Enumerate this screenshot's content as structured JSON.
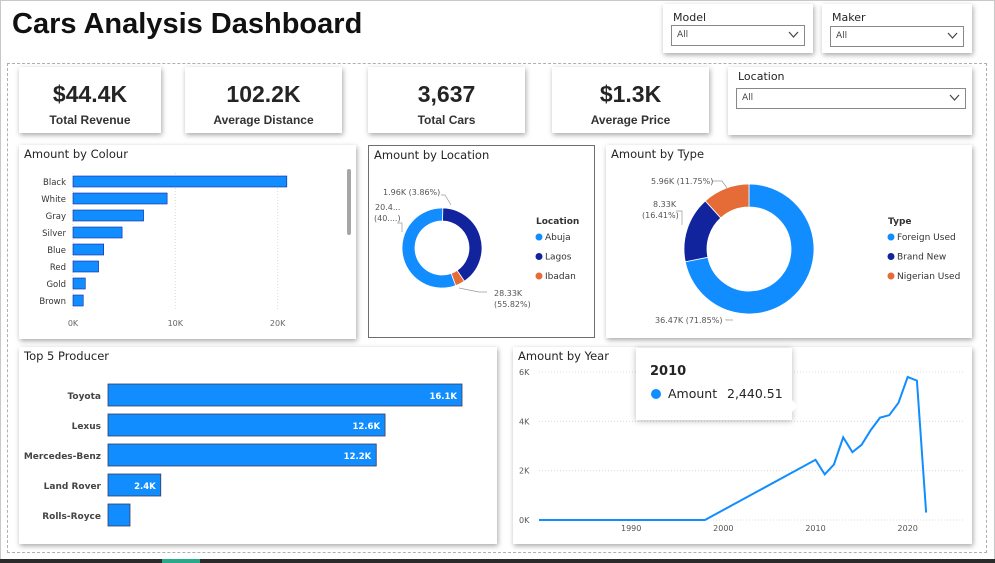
{
  "title": "Cars Analysis Dashboard",
  "colors": {
    "primary": "#118DFF",
    "navy": "#12239E",
    "orange": "#E66C37"
  },
  "slicers": {
    "model": {
      "title": "Model",
      "value": "All"
    },
    "maker": {
      "title": "Maker",
      "value": "All"
    },
    "location": {
      "title": "Location",
      "value": "All"
    }
  },
  "kpis": [
    {
      "value": "$44.4K",
      "label": "Total Revenue"
    },
    {
      "value": "102.2K",
      "label": "Average Distance"
    },
    {
      "value": "3,637",
      "label": "Total Cars"
    },
    {
      "value": "$1.3K",
      "label": "Average Price"
    }
  ],
  "tooltip": {
    "title": "2010",
    "series": "Amount",
    "value": "2,440.51"
  },
  "chart_data": [
    {
      "type": "bar",
      "title": "Amount by Colour",
      "orientation": "horizontal",
      "categories": [
        "Black",
        "White",
        "Gray",
        "Silver",
        "Blue",
        "Red",
        "Gold",
        "Brown"
      ],
      "values": [
        20900,
        9200,
        6900,
        4800,
        3000,
        2500,
        1200,
        1000
      ],
      "xlim": [
        0,
        26000
      ],
      "x_ticks": [
        "0K",
        "10K",
        "20K"
      ],
      "grid": true
    },
    {
      "type": "pie",
      "title": "Amount by Location",
      "donut": true,
      "legend_title": "Location",
      "legend_position": "right",
      "labels": [
        "Abuja",
        "Lagos",
        "Ibadan"
      ],
      "values": [
        28.33,
        20.4,
        1.96
      ],
      "data_labels": [
        "28.33K",
        "(55.82%)",
        "20.4...",
        "(40....)",
        "1.96K (3.86%)"
      ]
    },
    {
      "type": "pie",
      "title": "Amount by Type",
      "donut": true,
      "legend_title": "Type",
      "legend_position": "right",
      "labels": [
        "Foreign Used",
        "Brand New",
        "Nigerian Used"
      ],
      "values": [
        36.47,
        8.33,
        5.96
      ],
      "data_labels": [
        "36.47K (71.85%)",
        "8.33K",
        "(16.41%)",
        "5.96K (11.75%)"
      ]
    },
    {
      "type": "bar",
      "title": "Top 5 Producer",
      "orientation": "horizontal",
      "categories": [
        "Toyota",
        "Lexus",
        "Mercedes-Benz",
        "Land Rover",
        "Rolls-Royce"
      ],
      "values": [
        16.1,
        12.6,
        12.2,
        2.4,
        1.0
      ],
      "value_labels": [
        "16.1K",
        "12.6K",
        "12.2K",
        "2.4K",
        ""
      ]
    },
    {
      "type": "line",
      "title": "Amount by Year",
      "x": [
        1980,
        1998,
        2010,
        2011,
        2012,
        2013,
        2014,
        2015,
        2016,
        2017,
        2018,
        2019,
        2020,
        2021,
        2022
      ],
      "y": [
        0,
        0,
        2440.51,
        1850,
        2250,
        3350,
        2750,
        3050,
        3650,
        4150,
        4250,
        4750,
        5800,
        5650,
        300
      ],
      "xlim": [
        1980,
        2026
      ],
      "ylim": [
        0,
        6000
      ],
      "x_ticks": [
        "1990",
        "2000",
        "2010",
        "2020"
      ],
      "y_ticks": [
        "0K",
        "2K",
        "4K",
        "6K"
      ],
      "grid": true
    }
  ]
}
